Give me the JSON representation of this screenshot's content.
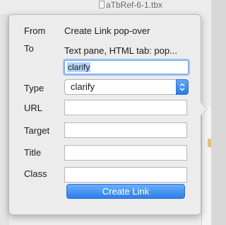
{
  "background_window": {
    "title": "aTbRef-6-1.tbx"
  },
  "popover": {
    "from_label": "From",
    "from_value": "Create Link pop-over",
    "to_label": "To",
    "to_value": "Text pane, HTML tab: pop...",
    "anchor_text_value": "clarify",
    "type_label": "Type",
    "type_selected": "clarify",
    "url_label": "URL",
    "url_value": "",
    "target_label": "Target",
    "target_value": "",
    "title_label": "Title",
    "title_value": "",
    "class_label": "Class",
    "class_value": "",
    "create_button_label": "Create Link"
  },
  "colors": {
    "accent": "#2d7ee9",
    "focus_ring": "#9dc2f5",
    "selection": "#b3d3fd"
  }
}
